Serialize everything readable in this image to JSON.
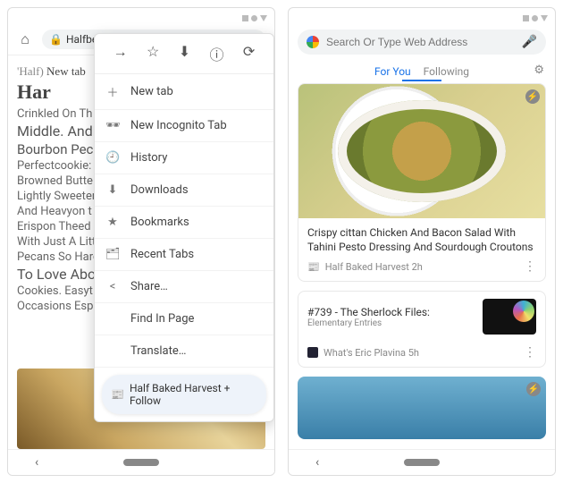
{
  "left": {
    "urlText": "halfb…",
    "urlPrefix": "Halfbe",
    "menu": {
      "top": [
        "→",
        "☆",
        "⬇",
        "ⓘ",
        "⟳"
      ],
      "newtab": "New tab",
      "incognito": "New Incognito Tab",
      "history": "History",
      "downloads": "Downloads",
      "bookmarks": "Bookmarks",
      "recentTabs": "Recent Tabs",
      "share": "Share…",
      "findInPage": "Find In Page",
      "translate": "Translate…",
      "follow": "Half Baked Harvest + Follow"
    },
    "page": {
      "heading": "Har",
      "pretitle": "'Half)",
      "lines": [
        "Crinkled On Th",
        "Middle. Andloh",
        "Bourbon Pecan /",
        "Perfectcookie:",
        "Browned Butte",
        "Lightly Sweeten Co",
        "And Heavyon t",
        "Erispon Theed",
        "With Just A Littk A)",
        "Pecans So Hard",
        "To Love About Th",
        "Cookies. Easyt",
        "Occasions Esp Esp"
      ]
    }
  },
  "right": {
    "searchPlaceholder": "Search Or Type Web Address",
    "tabs": {
      "forYou": "For You",
      "following": "Following"
    },
    "card1": {
      "title": "Crispy cittan Chicken And Bacon Salad With Tahini Pesto Dressing And Sourdough Croutons",
      "source": "Half Baked Harvest 2h"
    },
    "card2": {
      "title": "#739 - The Sherlock Files:",
      "subtitle": "Elementary Entries",
      "source": "What's Eric Plavina 5h"
    }
  }
}
